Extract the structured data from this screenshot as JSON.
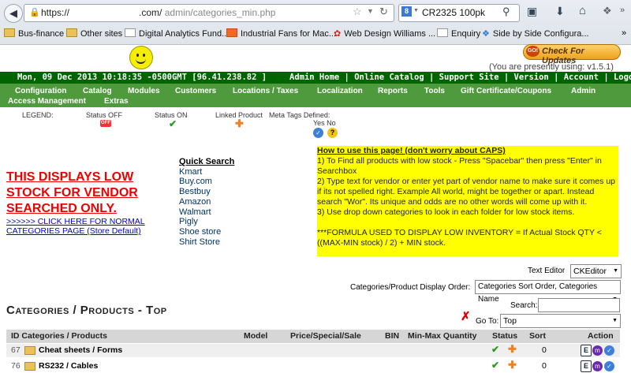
{
  "browser": {
    "url_prefix": "https://",
    "url_domain": ".com/",
    "url_path": "admin/categories_min.php",
    "search_value": "CR2325 100pk",
    "bookmarks": [
      "Bus-finance",
      "Other sites",
      "Digital Analytics Fund...",
      "Industrial Fans for Mac...",
      "Web Design Williams ...",
      "Enquiry",
      "Side by Side Configura..."
    ]
  },
  "header": {
    "check_updates": "Check For Updates",
    "go_badge": "GO!",
    "using": "(You are presently using: v1.5.1)",
    "datetime": "Mon, 09 Dec 2013 10:18:35 -0500GMT [96.41.238.82 ]",
    "top_links": [
      "Admin Home",
      "Online Catalog",
      "Support Site",
      "Version",
      "Account",
      "Logoff"
    ],
    "nav_row1": [
      "Configuration",
      "Catalog",
      "Modules",
      "Customers",
      "Locations / Taxes",
      "Localization",
      "Reports",
      "Tools",
      "Gift Certificate/Coupons",
      "Admin"
    ],
    "nav_row2": [
      "Access Management",
      "Extras"
    ]
  },
  "legend": {
    "label": "LEGEND:",
    "status_off": "Status OFF",
    "off_badge": "OFF",
    "status_on": "Status ON",
    "linked": "Linked Product",
    "meta": "Meta Tags Defined:",
    "yes_no": "Yes No"
  },
  "low_stock": {
    "title": "THIS DISPLAYS LOW STOCK FOR VENDOR SEARCHED ONLY.",
    "link": ">>>>>> CLICK HERE FOR NORMAL CATEGORIES PAGE (Store Default)"
  },
  "quick_search": {
    "title": "Quick Search",
    "items": [
      "Kmart",
      "Buy.com",
      "Bestbuy",
      "Amazon",
      "Walmart",
      "Pigly",
      "Shoe store",
      "Shirt Store"
    ]
  },
  "howto": {
    "title": "How to use this page! (don't worry about CAPS)",
    "lines": [
      "1) To Find all products with low stock - Press \"Spacebar\" then press \"Enter\" in Searchbox",
      "2) Type text for vendor or enter yet part of vendor name to make sure it comes up if its not spelled right. Example All world, might be together or apart. Instead search \"Wor\". Its unique and odds are no other words will come up with it.",
      "3) Use drop down categories to look in each folder for low stock items.",
      "",
      "***FORMULA USED TO DISPLAY LOW INVENTORY = If Actual Stock QTY < ((MAX-MIN stock) / 2) + MIN stock."
    ]
  },
  "controls": {
    "editor_label": "Text Editor",
    "editor_value": "CKEditor",
    "order_label": "Categories/Product Display Order:",
    "order_value": "Categories Sort Order, Categories Name",
    "search_label": "Search:",
    "goto_label": "Go To:",
    "goto_value": "Top"
  },
  "table": {
    "title": "Categories / Products - Top",
    "headers": [
      "ID Categories / Products",
      "Model",
      "Price/Special/Sale",
      "BIN",
      "Min-Max Quantity",
      "Status",
      "Sort",
      "Action"
    ],
    "rows": [
      {
        "id": "67",
        "name": "Cheat sheets / Forms",
        "sort": "0"
      },
      {
        "id": "76",
        "name": "RS232 / Cables",
        "sort": "0"
      }
    ]
  },
  "colors": {
    "topbar": "#006400",
    "navbar": "#4f9a3d",
    "howto_bg": "#ffff00",
    "alert": "#e00000"
  }
}
